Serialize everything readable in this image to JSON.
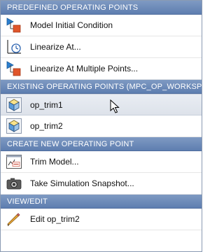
{
  "sections": [
    {
      "header": "PREDEFINED OPERATING POINTS",
      "items": [
        {
          "label": "Model Initial Condition",
          "icon": "model-initial-condition-icon"
        },
        {
          "label": "Linearize At...",
          "icon": "linearize-at-icon"
        },
        {
          "label": "Linearize At Multiple Points...",
          "icon": "linearize-multiple-points-icon"
        }
      ]
    },
    {
      "header": "EXISTING OPERATING POINTS (MPC_OP_WORKSPACE)",
      "items": [
        {
          "label": "op_trim1",
          "icon": "operating-point-cube-icon",
          "hovered": true
        },
        {
          "label": "op_trim2",
          "icon": "operating-point-cube-icon"
        }
      ]
    },
    {
      "header": "CREATE NEW OPERATING POINT",
      "items": [
        {
          "label": "Trim Model...",
          "icon": "trim-model-icon"
        },
        {
          "label": "Take Simulation Snapshot...",
          "icon": "camera-icon"
        }
      ]
    },
    {
      "header": "VIEW/EDIT",
      "items": [
        {
          "label": "Edit op_trim2",
          "icon": "pencil-icon"
        }
      ]
    }
  ]
}
